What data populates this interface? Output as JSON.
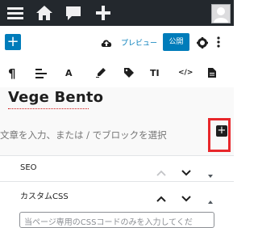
{
  "admin_bar": {
    "icons": [
      "menu-icon",
      "home-icon",
      "comment-icon",
      "plus-icon",
      "avatar"
    ]
  },
  "editor_header": {
    "add_block_label": "+",
    "preview_label": "プレビュー",
    "publish_label": "公開",
    "icons": [
      "cloud-upload-icon",
      "gear-icon",
      "more-vertical-icon"
    ]
  },
  "block_toolbar": {
    "paragraph_symbol": "¶",
    "items": [
      "paragraph-icon",
      "align-icon",
      "text-color-icon",
      "marker-icon",
      "tag-icon",
      "text-size-icon",
      "code-icon",
      "document-icon"
    ],
    "text_color_label": "A",
    "code_label": "</>",
    "text_size_label": "TI"
  },
  "content": {
    "title": "Vege Bento",
    "block_placeholder": "文章を入力、または / でブロックを選択",
    "inline_add_label": "+"
  },
  "meta_panels": {
    "seo": {
      "title": "SEO"
    },
    "custom_css": {
      "title": "カスタムCSS",
      "textarea_placeholder": "当ページ専用のCSSコードのみを入力してくだ"
    }
  },
  "colors": {
    "admin_bar": "#23282d",
    "accent": "#007cba",
    "highlight": "#e8272b"
  }
}
